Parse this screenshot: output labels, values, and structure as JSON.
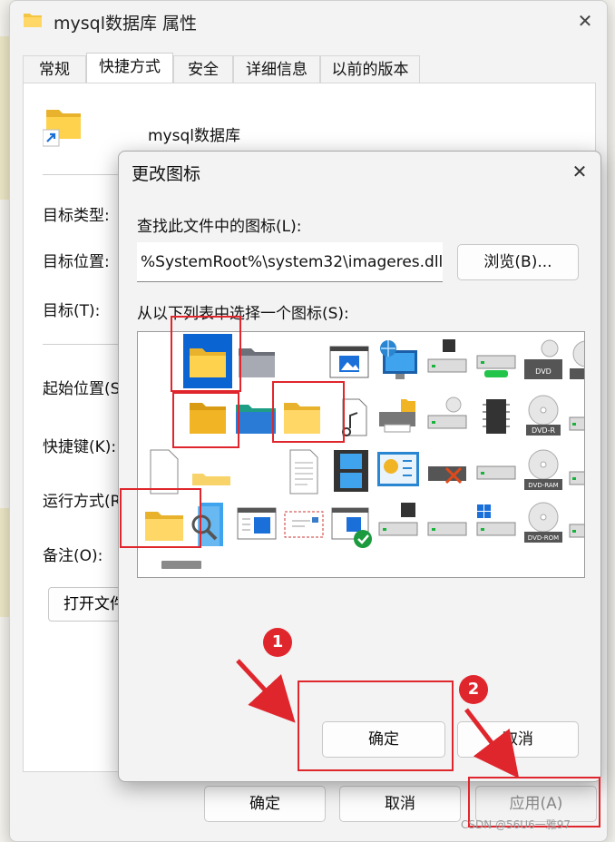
{
  "props_window": {
    "title": "mysql数据库 属性",
    "close_glyph": "✕",
    "tabs": [
      {
        "label": "常规"
      },
      {
        "label": "快捷方式"
      },
      {
        "label": "安全"
      },
      {
        "label": "详细信息"
      },
      {
        "label": "以前的版本"
      }
    ],
    "shortcut_name": "mysql数据库",
    "labels": {
      "target_type": "目标类型:",
      "target_location": "目标位置:",
      "target": "目标(T):",
      "start_in": "起始位置(S",
      "shortcut_key": "快捷键(K):",
      "run": "运行方式(R",
      "comment": "备注(O):"
    },
    "open_file_button": "打开文件",
    "buttons": {
      "ok": "确定",
      "cancel": "取消",
      "apply": "应用(A)"
    }
  },
  "change_icon_dialog": {
    "title": "更改图标",
    "close_glyph": "✕",
    "find_label": "查找此文件中的图标(L):",
    "path_value": "%SystemRoot%\\system32\\imageres.dll",
    "browse_button": "浏览(B)...",
    "list_label": "从以下列表中选择一个图标(S):",
    "disc_labels": {
      "dvd": "DVD",
      "dvdr": "DVD-R",
      "dvdram": "DVD-RAM",
      "dvdrom": "DVD-ROM"
    },
    "ok_button": "确定",
    "cancel_button": "取消"
  },
  "annotations": {
    "step1": "1",
    "step2": "2"
  },
  "watermark": "CSDN @56U6一雅97",
  "colors": {
    "accent": "#0a64d2",
    "annotation_red": "#e0262d",
    "folder_yellow": "#f4c542"
  }
}
